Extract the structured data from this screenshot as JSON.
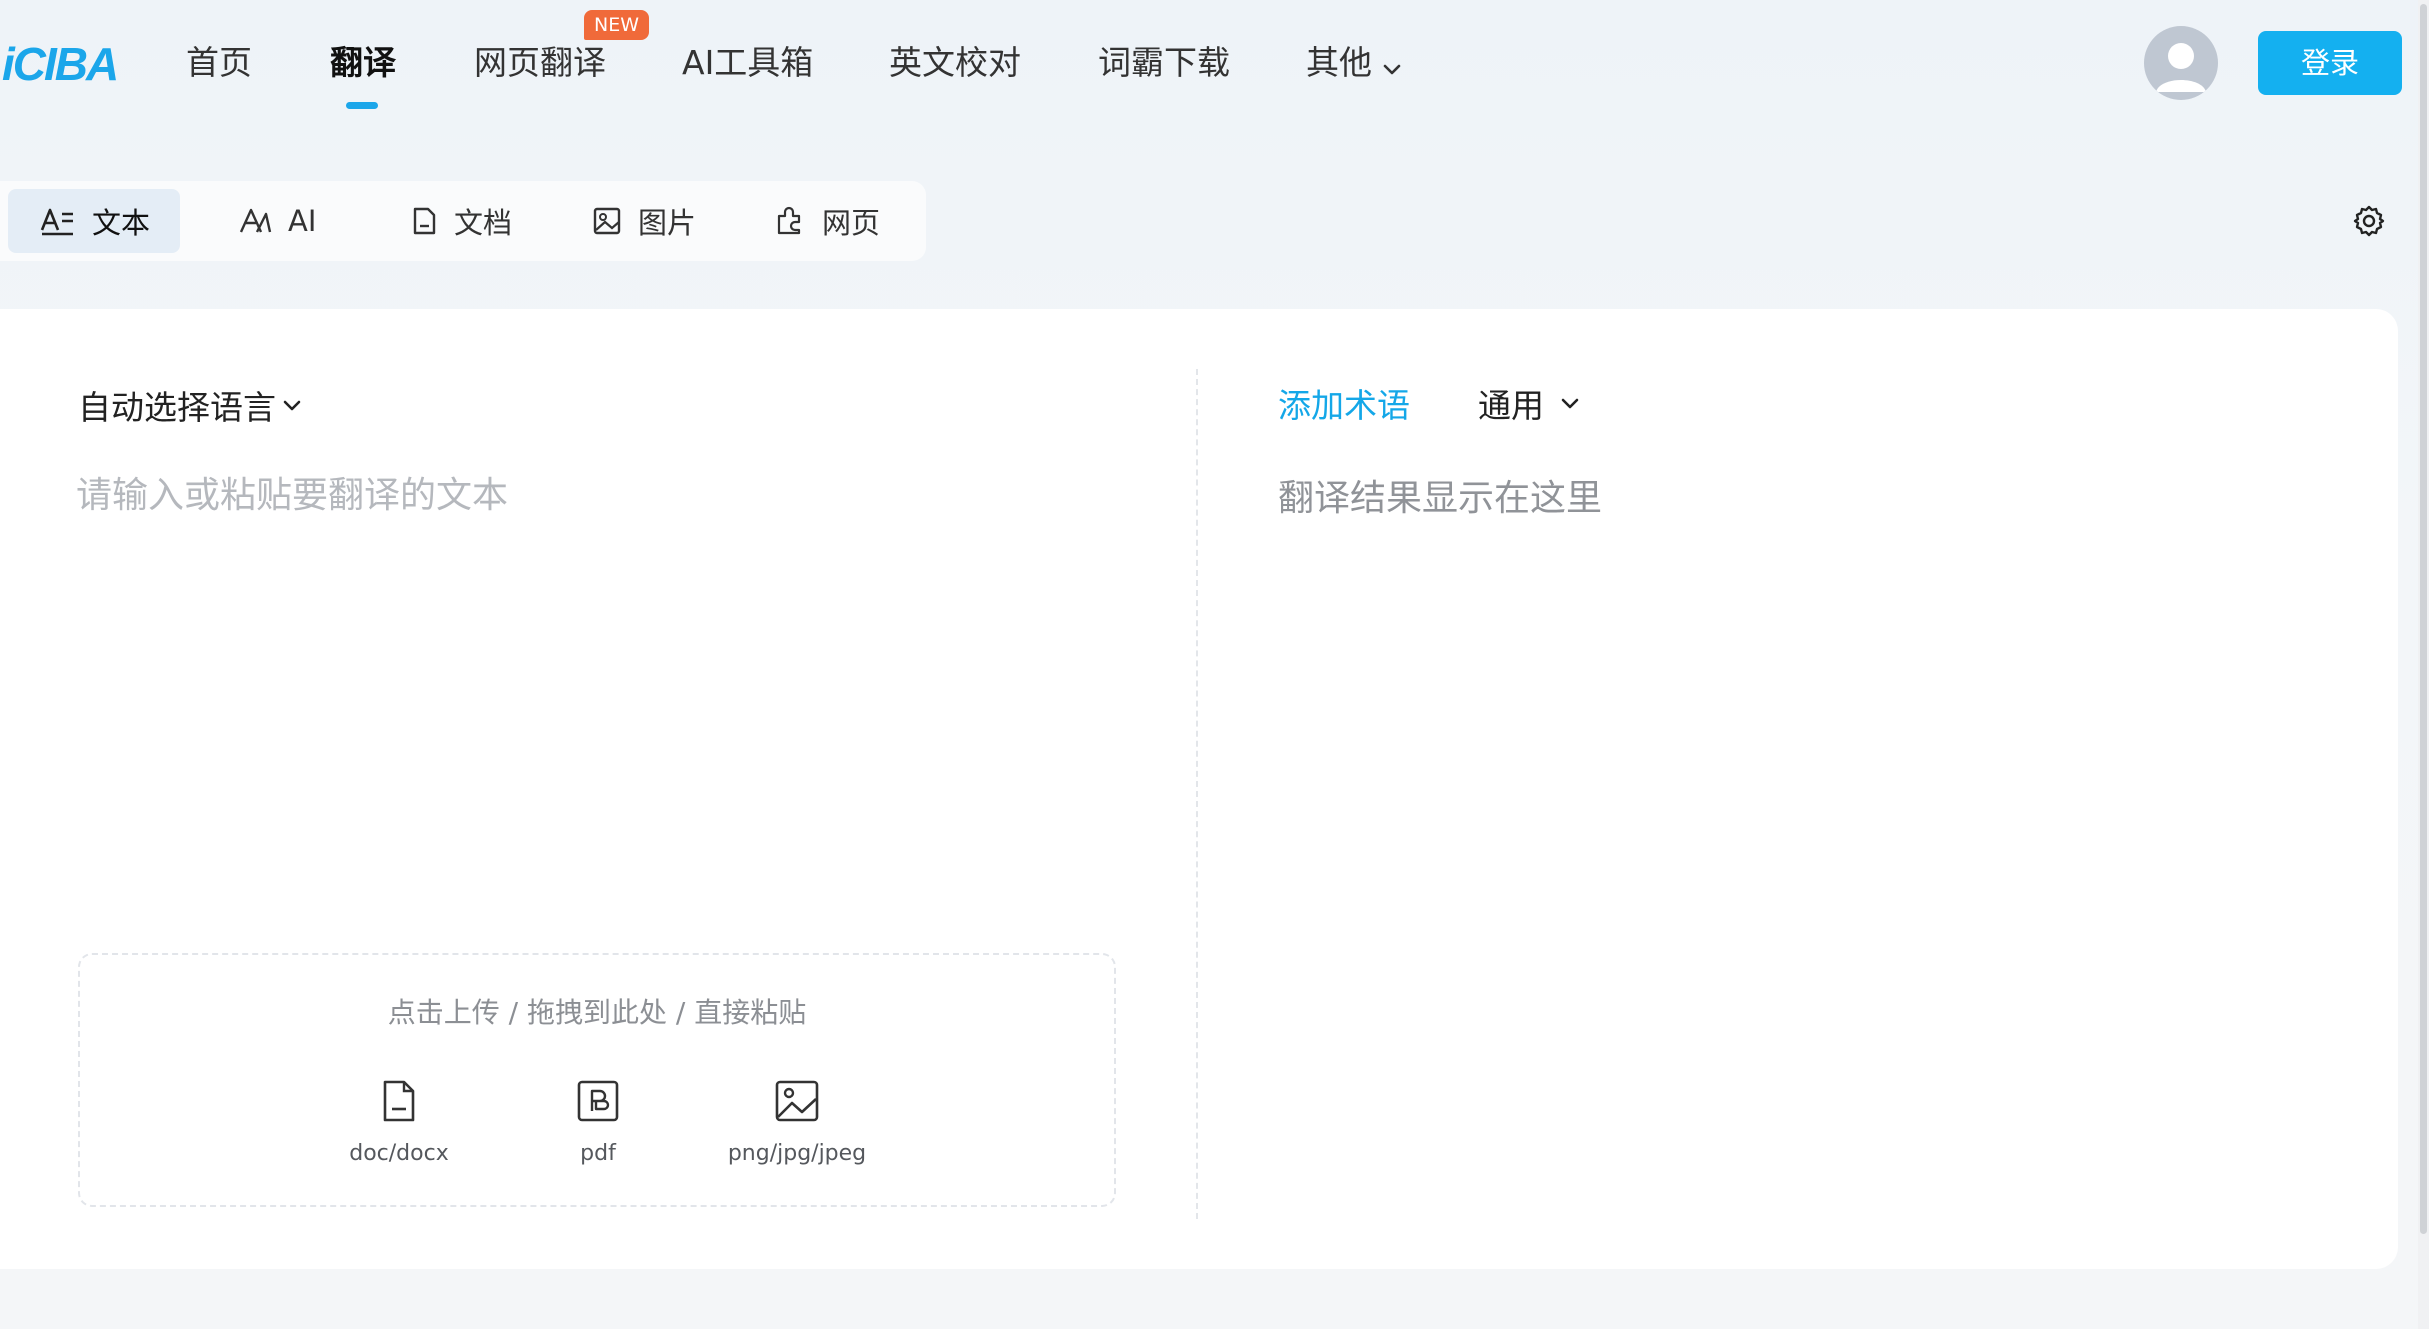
{
  "brand": {
    "logo": "iCIBA",
    "accent": "#1ba6ea",
    "badge_color": "#f06a3a"
  },
  "nav": {
    "items": [
      {
        "label": "首页"
      },
      {
        "label": "翻译"
      },
      {
        "label": "网页翻译",
        "badge": "NEW"
      },
      {
        "label": "AI工具箱"
      },
      {
        "label": "英文校对"
      },
      {
        "label": "词霸下载"
      },
      {
        "label": "其他"
      }
    ],
    "active": "翻译",
    "login_label": "登录"
  },
  "mode_tabs": [
    {
      "label": "文本",
      "icon": "text-translate-icon"
    },
    {
      "label": "AI",
      "icon": "ai-icon"
    },
    {
      "label": "文档",
      "icon": "document-icon"
    },
    {
      "label": "图片",
      "icon": "image-icon"
    },
    {
      "label": "网页",
      "icon": "webpage-icon"
    }
  ],
  "active_mode": "文本",
  "source": {
    "language_label": "自动选择语言",
    "placeholder": "请输入或粘贴要翻译的文本",
    "upload": {
      "hint": "点击上传 / 拖拽到此处 / 直接粘贴",
      "types": [
        {
          "label": "doc/docx",
          "icon": "doc-file-icon"
        },
        {
          "label": "pdf",
          "icon": "pdf-file-icon"
        },
        {
          "label": "png/jpg/jpeg",
          "icon": "image-file-icon"
        }
      ]
    }
  },
  "target": {
    "add_term_label": "添加术语",
    "domain_label": "通用",
    "result_placeholder": "翻译结果显示在这里"
  }
}
